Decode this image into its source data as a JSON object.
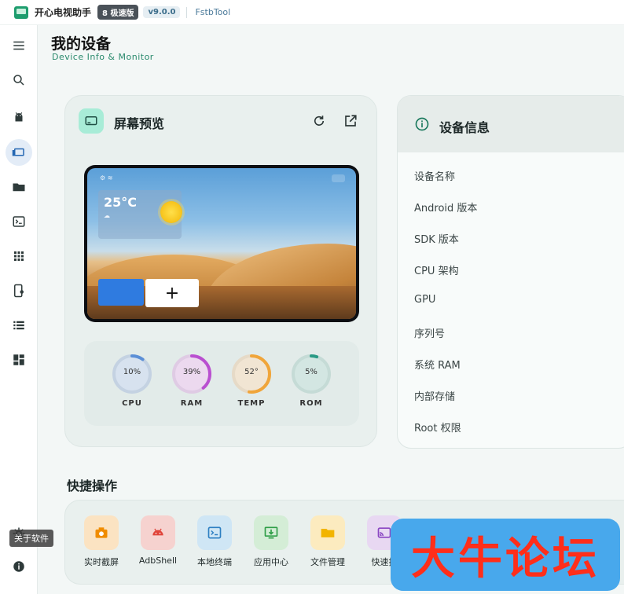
{
  "titlebar": {
    "app_name": "开心电视助手",
    "edition_badge": "8 极速版",
    "version_badge": "v9.0.0",
    "tool_link": "FstbTool"
  },
  "sidebar": {
    "items": [
      {
        "icon": "menu-icon"
      },
      {
        "icon": "search-icon"
      },
      {
        "icon": "android-icon"
      },
      {
        "icon": "devices-icon",
        "active": true
      },
      {
        "icon": "folder-icon"
      },
      {
        "icon": "terminal-icon"
      },
      {
        "icon": "apps-grid-icon"
      },
      {
        "icon": "device-settings-icon"
      },
      {
        "icon": "list-icon"
      },
      {
        "icon": "dashboard-icon"
      }
    ],
    "settings_icon": "gear-icon",
    "info_icon": "info-icon",
    "tooltip": "关于软件"
  },
  "header": {
    "title": "我的设备",
    "subtitle": "Device Info & Monitor"
  },
  "preview": {
    "title": "屏幕预览",
    "screen": {
      "weather_temp": "25°C"
    },
    "stats": [
      {
        "label": "CPU",
        "value": "10%",
        "percent": 10,
        "color": "#5b8fd6"
      },
      {
        "label": "RAM",
        "value": "39%",
        "percent": 39,
        "color": "#b94fd0"
      },
      {
        "label": "TEMP",
        "value": "52°",
        "percent": 52,
        "color": "#f0a53a"
      },
      {
        "label": "ROM",
        "value": "5%",
        "percent": 5,
        "color": "#2a9a85"
      }
    ]
  },
  "device_info": {
    "title": "设备信息",
    "rows": [
      "设备名称",
      "Android 版本",
      "SDK 版本",
      "CPU 架构",
      "GPU",
      "序列号",
      "系统 RAM",
      "内部存储",
      "Root 权限"
    ]
  },
  "quick_actions": {
    "title": "快捷操作",
    "items": [
      {
        "label": "实时截屏",
        "icon": "camera-icon",
        "bg": "#fbe3c2",
        "fg": "#f08c00"
      },
      {
        "label": "AdbShell",
        "icon": "android-icon",
        "bg": "#f6d2cf",
        "fg": "#e0443a"
      },
      {
        "label": "本地终端",
        "icon": "terminal-icon",
        "bg": "#cfe6f5",
        "fg": "#2d7fc2"
      },
      {
        "label": "应用中心",
        "icon": "download-icon",
        "bg": "#d4edd6",
        "fg": "#2f9e47"
      },
      {
        "label": "文件管理",
        "icon": "folder-icon",
        "bg": "#fcebbf",
        "fg": "#f2b400"
      },
      {
        "label": "快速投",
        "icon": "cast-icon",
        "bg": "#e8d8f2",
        "fg": "#8a46c2"
      }
    ]
  },
  "watermark": {
    "text": "大牛论坛"
  }
}
